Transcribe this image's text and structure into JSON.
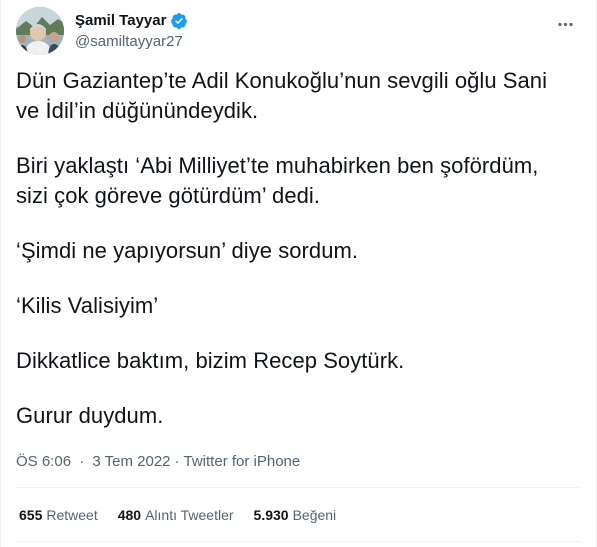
{
  "author": {
    "display_name": "Şamil Tayyar",
    "handle": "@samiltayyar27",
    "verified": true,
    "verified_color": "#1d9bf0"
  },
  "tweet": {
    "paragraphs": [
      "Dün Gaziantep’te Adil Konukoğlu’nun sevgili oğlu Sani\nve İdil’in düğünündeydik.",
      "Biri yaklaştı ‘Abi Milliyet’te muhabirken ben şofördüm,\nsizi çok göreve götürdüm’ dedi.",
      "‘Şimdi ne yapıyorsun’ diye sordum.",
      "‘Kilis Valisiyim’",
      "Dikkatlice baktım, bizim Recep Soytürk.",
      "Gurur duydum."
    ]
  },
  "meta": {
    "time": "ÖS 6:06",
    "separator": "·",
    "date": "3 Tem 2022",
    "source": "Twitter for iPhone"
  },
  "stats": {
    "retweets": {
      "count": "655",
      "label": "Retweet"
    },
    "quotes": {
      "count": "480",
      "label": "Alıntı Tweetler"
    },
    "likes": {
      "count": "5.930",
      "label": "Beğeni"
    }
  },
  "icons": {
    "verified": "verified-badge-icon",
    "more": "more-dots-icon"
  }
}
